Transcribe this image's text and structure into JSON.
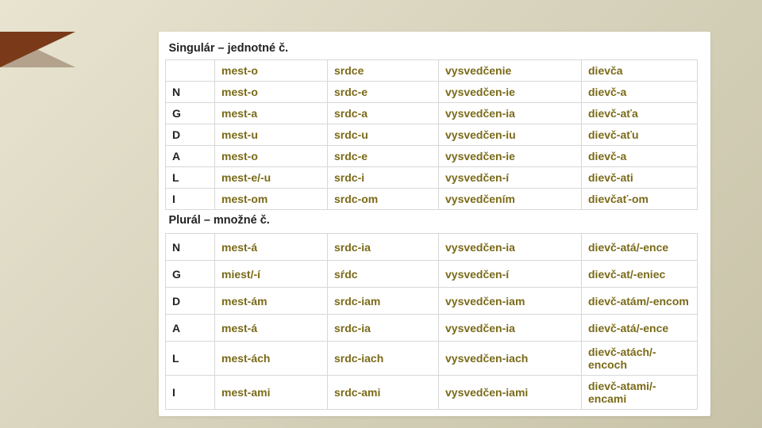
{
  "accent": {
    "color": "#7a3a1a"
  },
  "singular": {
    "title": "Singulár – jednotné č.",
    "headers": [
      "",
      "mest-o",
      "srdce",
      "vysvedčenie",
      "dievča"
    ],
    "rows": [
      {
        "case": "N",
        "a": "mest-o",
        "b": "srdc-e",
        "c": "vysvedčen-ie",
        "d": "dievč-a"
      },
      {
        "case": "G",
        "a": "mest-a",
        "b": "srdc-a",
        "c": "vysvedčen-ia",
        "d": "dievč-aťa"
      },
      {
        "case": "D",
        "a": "mest-u",
        "b": "srdc-u",
        "c": "vysvedčen-iu",
        "d": "dievč-aťu"
      },
      {
        "case": "A",
        "a": "mest-o",
        "b": "srdc-e",
        "c": "vysvedčen-ie",
        "d": "dievč-a"
      },
      {
        "case": "L",
        "a": "mest-e/-u",
        "b": "srdc-i",
        "c": "vysvedčen-í",
        "d": "dievč-ati"
      },
      {
        "case": "I",
        "a": "mest-om",
        "b": "srdc-om",
        "c": "vysvedčením",
        "d": "dievčať-om"
      }
    ]
  },
  "plural": {
    "title": "Plurál – množné č.",
    "rows": [
      {
        "case": "N",
        "a": "mest-á",
        "b": "srdc-ia",
        "c": "vysvedčen-ia",
        "d": "dievč-atá/-ence"
      },
      {
        "case": "G",
        "a": "miest/-í",
        "b": "sŕdc",
        "c": "vysvedčen-í",
        "d": "dievč-at/-eniec"
      },
      {
        "case": "D",
        "a": "mest-ám",
        "b": "srdc-iam",
        "c": "vysvedčen-iam",
        "d": "dievč-atám/-encom"
      },
      {
        "case": "A",
        "a": "mest-á",
        "b": "srdc-ia",
        "c": "vysvedčen-ia",
        "d": "dievč-atá/-ence"
      },
      {
        "case": "L",
        "a": "mest-ách",
        "b": "srdc-iach",
        "c": "vysvedčen-iach",
        "d": "dievč-atách/-encoch"
      },
      {
        "case": "I",
        "a": "mest-ami",
        "b": "srdc-ami",
        "c": "vysvedčen-iami",
        "d": "dievč-atami/-encami"
      }
    ]
  }
}
